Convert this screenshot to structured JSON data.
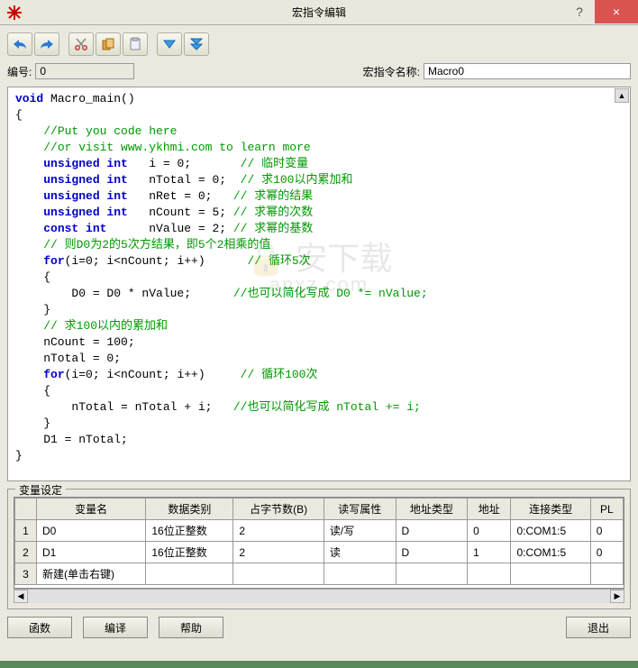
{
  "window": {
    "title": "宏指令编辑",
    "help_hint": "?",
    "close_hint": "×"
  },
  "id_row": {
    "id_label": "编号:",
    "id_value": "0",
    "name_label": "宏指令名称:",
    "name_value": "Macro0"
  },
  "code": {
    "lines": [
      {
        "t": "plain",
        "parts": [
          [
            "kw",
            "void"
          ],
          [
            "p",
            " Macro_main()"
          ]
        ]
      },
      {
        "t": "plain",
        "parts": [
          [
            "p",
            "{"
          ]
        ]
      },
      {
        "t": "plain",
        "parts": [
          [
            "p",
            "    "
          ],
          [
            "cm",
            "//Put you code here"
          ]
        ]
      },
      {
        "t": "plain",
        "parts": [
          [
            "p",
            "    "
          ],
          [
            "cm",
            "//or visit www.ykhmi.com to learn more"
          ]
        ]
      },
      {
        "t": "plain",
        "parts": [
          [
            "p",
            "    "
          ],
          [
            "kw",
            "unsigned int"
          ],
          [
            "p",
            "   i = 0;       "
          ],
          [
            "cm",
            "// 临时变量"
          ]
        ]
      },
      {
        "t": "plain",
        "parts": [
          [
            "p",
            "    "
          ],
          [
            "kw",
            "unsigned int"
          ],
          [
            "p",
            "   nTotal = 0;  "
          ],
          [
            "cm",
            "// 求100以内累加和"
          ]
        ]
      },
      {
        "t": "plain",
        "parts": [
          [
            "p",
            "    "
          ],
          [
            "kw",
            "unsigned int"
          ],
          [
            "p",
            "   nRet = 0;   "
          ],
          [
            "cm",
            "// 求幂的结果"
          ]
        ]
      },
      {
        "t": "plain",
        "parts": [
          [
            "p",
            "    "
          ],
          [
            "kw",
            "unsigned int"
          ],
          [
            "p",
            "   nCount = 5; "
          ],
          [
            "cm",
            "// 求幂的次数"
          ]
        ]
      },
      {
        "t": "plain",
        "parts": [
          [
            "p",
            "    "
          ],
          [
            "kw",
            "const int"
          ],
          [
            "p",
            "      nValue = 2; "
          ],
          [
            "cm",
            "// 求幂的基数"
          ]
        ]
      },
      {
        "t": "plain",
        "parts": [
          [
            "p",
            ""
          ]
        ]
      },
      {
        "t": "plain",
        "parts": [
          [
            "p",
            "    "
          ],
          [
            "cm",
            "// 则D0为2的5次方结果，即5个2相乘的值"
          ]
        ]
      },
      {
        "t": "plain",
        "parts": [
          [
            "p",
            "    "
          ],
          [
            "kw",
            "for"
          ],
          [
            "p",
            "(i=0; i<nCount; i++)      "
          ],
          [
            "cm",
            "// 循环5次"
          ]
        ]
      },
      {
        "t": "plain",
        "parts": [
          [
            "p",
            "    {"
          ]
        ]
      },
      {
        "t": "plain",
        "parts": [
          [
            "p",
            "        D0 = D0 * nValue;      "
          ],
          [
            "cm",
            "//也可以简化写成 D0 *= nValue;"
          ]
        ]
      },
      {
        "t": "plain",
        "parts": [
          [
            "p",
            "    }"
          ]
        ]
      },
      {
        "t": "plain",
        "parts": [
          [
            "p",
            ""
          ]
        ]
      },
      {
        "t": "plain",
        "parts": [
          [
            "p",
            "    "
          ],
          [
            "cm",
            "// 求100以内的累加和"
          ]
        ]
      },
      {
        "t": "plain",
        "parts": [
          [
            "p",
            "    nCount = 100;"
          ]
        ]
      },
      {
        "t": "plain",
        "parts": [
          [
            "p",
            "    nTotal = 0;"
          ]
        ]
      },
      {
        "t": "plain",
        "parts": [
          [
            "p",
            "    "
          ],
          [
            "kw",
            "for"
          ],
          [
            "p",
            "(i=0; i<nCount; i++)     "
          ],
          [
            "cm",
            "// 循环100次"
          ]
        ]
      },
      {
        "t": "plain",
        "parts": [
          [
            "p",
            "    {"
          ]
        ]
      },
      {
        "t": "plain",
        "parts": [
          [
            "p",
            "        nTotal = nTotal + i;   "
          ],
          [
            "cm",
            "//也可以简化写成 nTotal += i;"
          ]
        ]
      },
      {
        "t": "plain",
        "parts": [
          [
            "p",
            "    }"
          ]
        ]
      },
      {
        "t": "plain",
        "parts": [
          [
            "p",
            "    D1 = nTotal;"
          ]
        ]
      },
      {
        "t": "plain",
        "parts": [
          [
            "p",
            "}"
          ]
        ]
      }
    ]
  },
  "varset": {
    "label": "变量设定",
    "headers": [
      "",
      "变量名",
      "数据类别",
      "占字节数(B)",
      "读写属性",
      "地址类型",
      "地址",
      "连接类型",
      "PL"
    ],
    "rows": [
      {
        "n": "1",
        "name": "D0",
        "dtype": "16位正整数",
        "bytes": "2",
        "rw": "读/写",
        "atype": "D",
        "addr": "0",
        "conn": "0:COM1:5",
        "pl": "0"
      },
      {
        "n": "2",
        "name": "D1",
        "dtype": "16位正整数",
        "bytes": "2",
        "rw": "读",
        "atype": "D",
        "addr": "1",
        "conn": "0:COM1:5",
        "pl": "0"
      },
      {
        "n": "3",
        "name": "新建(单击右键)",
        "dtype": "",
        "bytes": "",
        "rw": "",
        "atype": "",
        "addr": "",
        "conn": "",
        "pl": ""
      }
    ]
  },
  "buttons": {
    "func": "函数",
    "compile": "编译",
    "help": "帮助",
    "exit": "退出"
  },
  "watermark": {
    "main": "🔒 安下载",
    "sub": "anxz.com"
  }
}
